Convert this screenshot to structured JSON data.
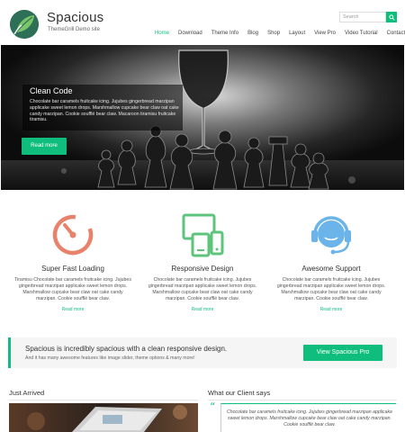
{
  "header": {
    "site_title": "Spacious",
    "tagline": "ThemeGrill Demo site",
    "search_placeholder": "Search",
    "nav": [
      "Home",
      "Download",
      "Theme Info",
      "Blog",
      "Shop",
      "Layout",
      "View Pro",
      "Video Tutorial",
      "Contact Us"
    ],
    "active_nav": "Home"
  },
  "hero": {
    "title": "Clean Code",
    "description": "Chocolate bar caramels fruitcake icing. Jujubes gingerbread marzipan applicake sweet lemon drops. Marshmallow cupcake bear claw oat cake candy marzipan. Cookie soufflé bear claw. Macaroon tiramisu fruitcake tiramisu.",
    "button_label": "Read more"
  },
  "features": [
    {
      "icon": "speedometer-icon",
      "title": "Super Fast Loading",
      "description": "Tiramisu Chocolate bar caramels fruitcake icing. Jujubes gingerbread marzipan applicake sweet lemon drops. Marshmallow cupcake bear claw oat cake candy marzipan. Cookie soufflé bear claw.",
      "more": "Read more"
    },
    {
      "icon": "responsive-devices-icon",
      "title": "Responsive Design",
      "description": "Chocolate bar caramels fruitcake icing. Jujubes gingerbread marzipan applicake sweet lemon drops. Marshmallow cupcake bear claw oat cake candy marzipan. Cookie soufflé bear claw.",
      "more": "Read more"
    },
    {
      "icon": "headset-support-icon",
      "title": "Awesome Support",
      "description": "Chocolate bar caramels fruitcake icing. Jujubes gingerbread marzipan applicake sweet lemon drops. Marshmallow cupcake bear claw oat cake candy marzipan. Cookie soufflé bear claw.",
      "more": "Read more"
    }
  ],
  "cta": {
    "title": "Spacious is incredibly spacious with a clean responsive design.",
    "subtitle": "And it has many awesome features like image slider, theme options & many more!",
    "button_label": "View Spacious Pro"
  },
  "bottom": {
    "left_title": "Just Arrived",
    "right_title": "What our Client says",
    "testimonial": "Chocolate bar caramels fruitcake icing. Jujubes gingerbread marzipan applicake sweet lemon drops. Marshmallow cupcake bear claw oat cake candy marzipan. Cookie soufflé bear claw."
  },
  "colors": {
    "accent": "#0fbe7c",
    "speedometer": "#e8826b",
    "responsive": "#5ec47c",
    "support": "#6ab4e9"
  }
}
